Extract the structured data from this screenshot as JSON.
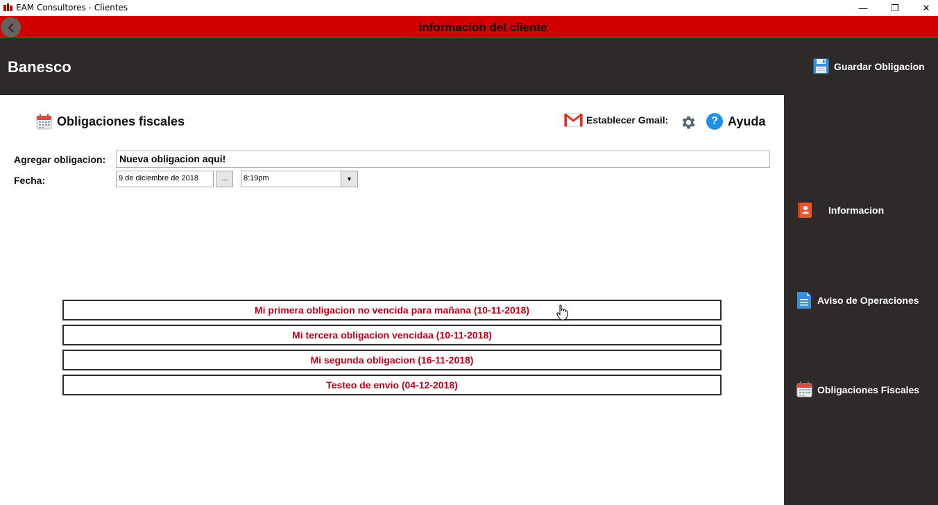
{
  "window": {
    "title": "EAM Consultores - Clientes",
    "controls": {
      "minimize": "—",
      "restore": "❐",
      "close": "✕"
    }
  },
  "header": {
    "title": "Informacion del cliente",
    "back_icon": "chevron-left-icon"
  },
  "client": {
    "name": "Banesco",
    "save_label": "Guardar Obligacion"
  },
  "main": {
    "section_title": "Obligaciones fiscales",
    "gmail_label": "Establecer Gmail:",
    "help_label": "Ayuda",
    "help_glyph": "?",
    "form": {
      "add_label": "Agregar obligacion:",
      "add_value": "Nueva obligacion aqui!",
      "date_label": "Fecha:",
      "date_value": "9 de diciembre de 2018",
      "date_button": "...",
      "time_value": "8:19pm",
      "time_button": "▼"
    },
    "obligations": [
      "Mi primera obligacion no vencida para mañana (10-11-2018)",
      "Mi tercera obligacion vencidaa (10-11-2018)",
      "Mi segunda obligacion (16-11-2018)",
      "Testeo de envio (04-12-2018)"
    ]
  },
  "sidebar": {
    "items": [
      {
        "label": "Informacion",
        "icon": "contact-icon"
      },
      {
        "label": "Aviso de Operaciones",
        "icon": "document-icon"
      },
      {
        "label": "Obligaciones Fiscales",
        "icon": "calendar-icon"
      }
    ]
  },
  "colors": {
    "header_red": "#d00000",
    "dark_panel": "#2f2a2a",
    "obligation_text": "#c0001a",
    "help_blue": "#1e90e6"
  }
}
